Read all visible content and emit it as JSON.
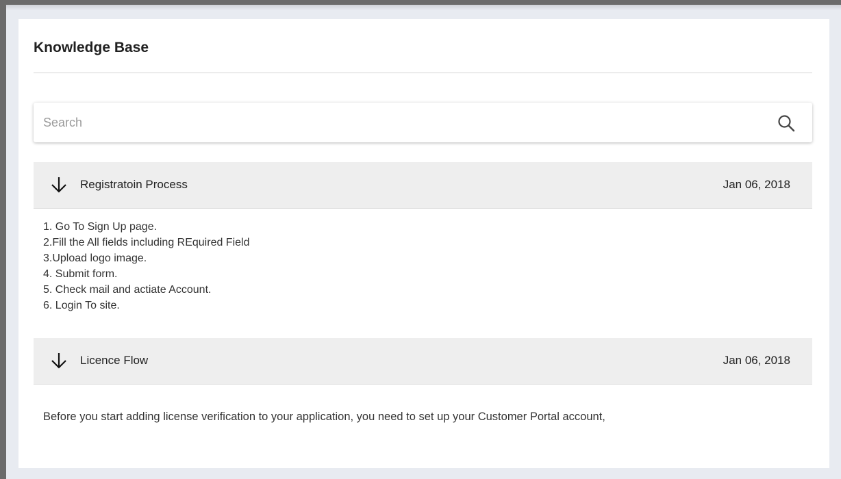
{
  "page": {
    "title": "Knowledge Base"
  },
  "search": {
    "placeholder": "Search",
    "value": "",
    "icon": "search-icon"
  },
  "articles": [
    {
      "title": "Registratoin Process",
      "date": "Jan 06, 2018",
      "icon": "arrow-down-icon",
      "expanded": true,
      "steps": [
        "1. Go To Sign Up page.",
        "2.Fill the All fields including REquired Field",
        "3.Upload logo image.",
        "4. Submit form.",
        "5. Check mail and actiate Account.",
        "6. Login To site."
      ]
    },
    {
      "title": "Licence Flow",
      "date": "Jan 06, 2018",
      "icon": "arrow-down-icon",
      "expanded": true,
      "body": "Before you start adding license verification to your application, you need to set up your Customer Portal account,"
    }
  ],
  "colors": {
    "page_background": "#e8ebf1",
    "card_background": "#ffffff",
    "accordion_header": "#eeeeee",
    "text_primary": "#212121",
    "placeholder": "#9b9b9b"
  }
}
